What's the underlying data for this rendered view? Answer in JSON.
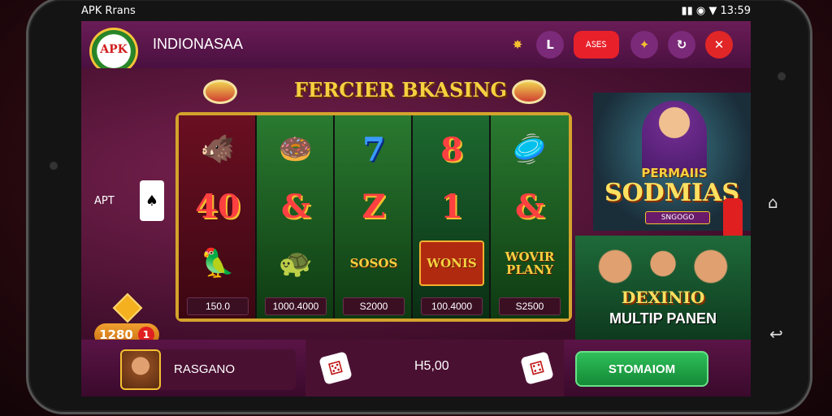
{
  "statusbar": {
    "left_text": "APK Rrans",
    "time": "13:59"
  },
  "topbar": {
    "logo_text": "APK",
    "app_title": "INDIONASAA",
    "letter_button": "L",
    "red_pill_text": "ᎪᏚᎬᏚ",
    "close_icon": "close-icon"
  },
  "main": {
    "banner_title": "FERCIER BKASING",
    "side_left_text": "APT",
    "side_card": "♠",
    "credit_amount": "1280",
    "credit_badge": "1",
    "reels": [
      {
        "symbols": [
          {
            "kind": "emoji",
            "v": "🐗"
          },
          {
            "kind": "num",
            "v": "40"
          },
          {
            "kind": "emoji",
            "v": "🦜"
          }
        ],
        "value": "150.0"
      },
      {
        "symbols": [
          {
            "kind": "emoji",
            "v": "🍩"
          },
          {
            "kind": "num",
            "v": "&"
          },
          {
            "kind": "emoji",
            "v": "🐢"
          }
        ],
        "value": "1000.4000"
      },
      {
        "symbols": [
          {
            "kind": "num-blue",
            "v": "7"
          },
          {
            "kind": "num",
            "v": "Z"
          },
          {
            "kind": "word",
            "v": "SOSOS"
          }
        ],
        "value": "S2000"
      },
      {
        "symbols": [
          {
            "kind": "num",
            "v": "8"
          },
          {
            "kind": "num",
            "v": "1"
          },
          {
            "kind": "word-box",
            "v": "WONIS"
          }
        ],
        "value": "100.4000"
      },
      {
        "symbols": [
          {
            "kind": "emoji",
            "v": "🥏"
          },
          {
            "kind": "num",
            "v": "&"
          },
          {
            "kind": "word",
            "v": "WOVIR PLANY"
          }
        ],
        "value": "S2500"
      }
    ]
  },
  "promo1": {
    "title1": "PERMAIIS",
    "title2": "SODMIAS",
    "sub": "SNGOGO"
  },
  "promo2": {
    "title": "DEXINIO",
    "subtitle": "MULTIP PANEN"
  },
  "bottombar": {
    "username": "RASGANO",
    "bet_amount": "H5,00",
    "spin_label": "STOMAIOM"
  },
  "colors": {
    "accent_gold": "#d4a32c",
    "spin_green": "#2fbf5a",
    "close_red": "#e02626"
  }
}
